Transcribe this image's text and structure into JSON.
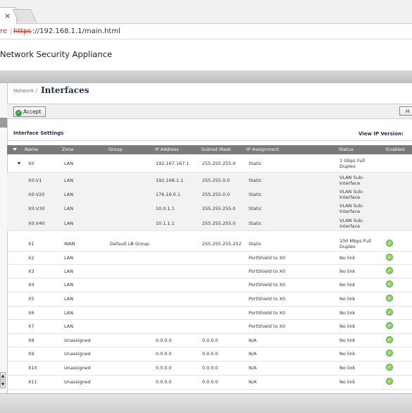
{
  "browser": {
    "tab_close": "×",
    "url_left": "re",
    "url_scheme": "https",
    "url_rest": "://192.168.1.1/main.html"
  },
  "app": {
    "title": "Network Security Appliance"
  },
  "page": {
    "breadcrumb": "Network /",
    "title": "Interfaces",
    "accept_label": "Accept",
    "help_label": "H",
    "settings_title": "Interface Settings",
    "view_ip_version": "View IP Version:"
  },
  "table": {
    "columns": [
      "Name",
      "Zone",
      "Group",
      "IP Address",
      "Subnet Mask",
      "IP Assignment",
      "Status",
      "Enabled"
    ],
    "rows": [
      {
        "name": "X0",
        "zone": "LAN",
        "group": "",
        "ip": "192.167.167.1",
        "mask": "255.255.255.0",
        "assign": "Static",
        "status": "1 Gbps Full Duplex",
        "enabled": false,
        "sub": false,
        "expand": true
      },
      {
        "name": "X0:V1",
        "zone": "LAN",
        "group": "",
        "ip": "192.168.1.1",
        "mask": "255.255.0.0",
        "assign": "Static",
        "status": "VLAN Sub-Interface",
        "enabled": false,
        "sub": true,
        "expand": false
      },
      {
        "name": "X0:V20",
        "zone": "LAN",
        "group": "",
        "ip": "176.16.0.1",
        "mask": "255.255.0.0",
        "assign": "Static",
        "status": "VLAN Sub-Interface",
        "enabled": false,
        "sub": true,
        "expand": false
      },
      {
        "name": "X0:V30",
        "zone": "LAN",
        "group": "",
        "ip": "10.0.1.1",
        "mask": "255.255.255.0",
        "assign": "Static",
        "status": "VLAN Sub-Interface",
        "enabled": false,
        "sub": true,
        "expand": false
      },
      {
        "name": "X0:V40",
        "zone": "LAN",
        "group": "",
        "ip": "10.1.1.1",
        "mask": "255.255.255.0",
        "assign": "Static",
        "status": "VLAN Sub-Interface",
        "enabled": false,
        "sub": true,
        "expand": false
      },
      {
        "name": "X1",
        "zone": "WAN",
        "group": "Default LB Group",
        "ip": "",
        "mask": "255.255.255.252",
        "assign": "Static",
        "status": "100 Mbps Full Duplex",
        "enabled": true,
        "sub": false,
        "expand": false
      },
      {
        "name": "X2",
        "zone": "LAN",
        "group": "",
        "ip": "",
        "mask": "",
        "assign": "PortShield to X0",
        "status": "No link",
        "enabled": true,
        "sub": false,
        "expand": false
      },
      {
        "name": "X3",
        "zone": "LAN",
        "group": "",
        "ip": "",
        "mask": "",
        "assign": "PortShield to X0",
        "status": "No link",
        "enabled": true,
        "sub": false,
        "expand": false
      },
      {
        "name": "X4",
        "zone": "LAN",
        "group": "",
        "ip": "",
        "mask": "",
        "assign": "PortShield to X0",
        "status": "No link",
        "enabled": true,
        "sub": false,
        "expand": false
      },
      {
        "name": "X5",
        "zone": "LAN",
        "group": "",
        "ip": "",
        "mask": "",
        "assign": "PortShield to X0",
        "status": "No link",
        "enabled": true,
        "sub": false,
        "expand": false
      },
      {
        "name": "X6",
        "zone": "LAN",
        "group": "",
        "ip": "",
        "mask": "",
        "assign": "PortShield to X0",
        "status": "No link",
        "enabled": true,
        "sub": false,
        "expand": false
      },
      {
        "name": "X7",
        "zone": "LAN",
        "group": "",
        "ip": "",
        "mask": "",
        "assign": "PortShield to X0",
        "status": "No link",
        "enabled": true,
        "sub": false,
        "expand": false
      },
      {
        "name": "X8",
        "zone": "Unassigned",
        "group": "",
        "ip": "0.0.0.0",
        "mask": "0.0.0.0",
        "assign": "N/A",
        "status": "No link",
        "enabled": true,
        "sub": false,
        "expand": false
      },
      {
        "name": "X9",
        "zone": "Unassigned",
        "group": "",
        "ip": "0.0.0.0",
        "mask": "0.0.0.0",
        "assign": "N/A",
        "status": "No link",
        "enabled": true,
        "sub": false,
        "expand": false
      },
      {
        "name": "X10",
        "zone": "Unassigned",
        "group": "",
        "ip": "0.0.0.0",
        "mask": "0.0.0.0",
        "assign": "N/A",
        "status": "No link",
        "enabled": true,
        "sub": false,
        "expand": false
      },
      {
        "name": "X11",
        "zone": "Unassigned",
        "group": "",
        "ip": "0.0.0.0",
        "mask": "0.0.0.0",
        "assign": "N/A",
        "status": "No link",
        "enabled": true,
        "sub": false,
        "expand": false
      }
    ]
  },
  "icons": {
    "enabled": "check-circle-icon",
    "accept": "check-icon"
  },
  "colors": {
    "title_navy": "#1d2f4f",
    "header_grey": "#7a7a7a",
    "enabled_green": "#8fcf6f"
  }
}
